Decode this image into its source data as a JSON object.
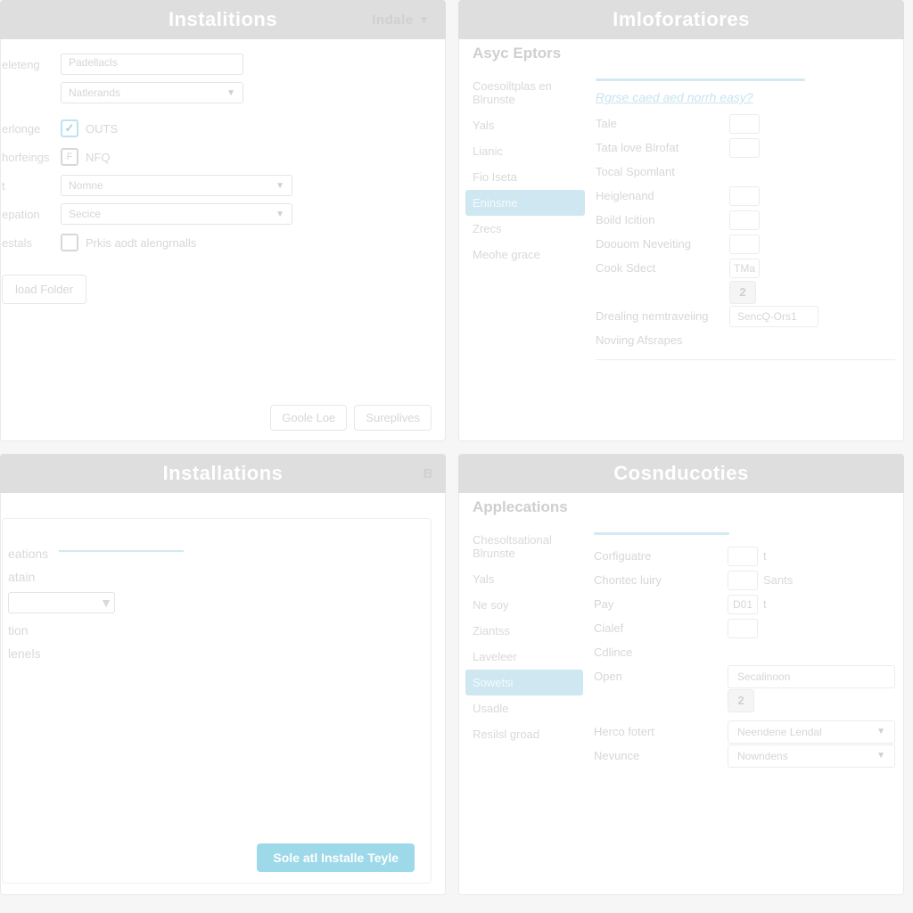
{
  "tl": {
    "title": "Instalitions",
    "header_right": "Indale",
    "labels": {
      "f1": "eleteng",
      "f2": "erlonge",
      "f3": "horfeings",
      "f4": "t",
      "f5": "epation",
      "f6": "estals"
    },
    "fields": {
      "text1": "Padellacls",
      "sel1": "Natlerands",
      "chk1": "OUTS",
      "chk2": "NFQ",
      "sel2": "Nomne",
      "sel3": "Secice",
      "chk3": "Prkis aodt alengrnalls"
    },
    "upload": "load Folder",
    "btn1": "Goole Loe",
    "btn2": "Sureplives"
  },
  "tr": {
    "title": "Imloforatiores",
    "subhead": "Asyc Eptors",
    "side": [
      "Coesoiltplas en Blrunste",
      "Yals",
      "Lianic",
      "Fio Iseta",
      "Eninsme",
      "Zrecs",
      "Meohe grace"
    ],
    "side_sel": 4,
    "link": "Rgrse caed aed norrh easy?",
    "rows": [
      {
        "k": "Tale",
        "box": ""
      },
      {
        "k": "Tata love Blrofat",
        "box": ""
      },
      {
        "k": "Tocal Spomlant"
      },
      {
        "k": "Heiglenand",
        "box": ""
      },
      {
        "k": "Boild Icition",
        "box": ""
      },
      {
        "k": "Doouom Neveiting",
        "box": ""
      },
      {
        "k": "Cook Sdect",
        "box": "TMa"
      }
    ],
    "num": "2",
    "row_dreal_k": "Drealing nemtraveiing",
    "row_dreal_v": "SencQ-Ors1",
    "row_nove": "Noviing Afsrapes"
  },
  "bl": {
    "title": "Installations",
    "badge": "B",
    "items": [
      "eations",
      "atain",
      "tion",
      "lenels",
      ""
    ],
    "btn": "Sole atl Installe Teyle"
  },
  "br": {
    "title": "Cosnducoties",
    "subhead": "Applecations",
    "side": [
      "Chesoltsational Blrunste",
      "Yals",
      "Ne soy",
      "Ziantss",
      "Laveleer",
      "Sowetsi",
      "Usadle",
      "Resilsl groad"
    ],
    "side_sel": 5,
    "rows": [
      {
        "k": "Corfiguatre",
        "box": "",
        "trail": "t"
      },
      {
        "k": "Chontec luiry",
        "box": "",
        "trail": "Sants"
      },
      {
        "k": "Pay",
        "box": "D01",
        "trail": "t"
      },
      {
        "k": "Cialef",
        "box": ""
      },
      {
        "k": "Cdlince"
      }
    ],
    "open_k": "Open",
    "open_v": "Secalinoon",
    "num": "2",
    "dd1_k": "Herco fotert",
    "dd1_v": "Neendene Lendal",
    "dd2_k": "Nevunce",
    "dd2_v": "Nowndens"
  }
}
